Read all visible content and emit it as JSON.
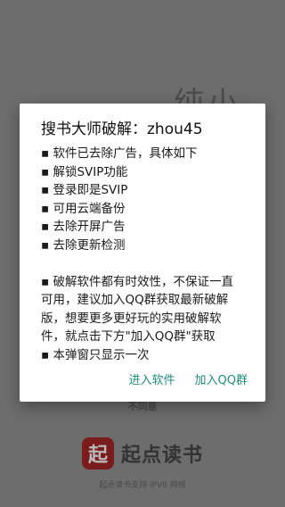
{
  "background": {
    "hand_text": "纯小",
    "disagree_label": "不同意",
    "brand_logo_char": "起",
    "brand_name": "起点读书",
    "support_text": "起点读书支持 IPV6 网络"
  },
  "dialog": {
    "title": "搜书大师破解：zhou45",
    "lines": [
      "▪ 软件已去除广告，具体如下",
      "▪ 解锁SVIP功能",
      "▪ 登录即是SVIP",
      "▪ 可用云端备份",
      "▪ 去除开屏广告",
      "▪ 去除更新检测",
      "",
      "▪ 破解软件都有时效性，不保证一直",
      "可用，建议加入QQ群获取最新破解",
      "版，想要更多更好玩的实用破解软",
      "件，就点击下方\"加入QQ群\"获取",
      "▪ 本弹窗只显示一次"
    ],
    "enter_button": "进入软件",
    "join_button": "加入QQ群"
  },
  "colors": {
    "accent": "#1f8f7d",
    "brand_logo": "#7a1c1c"
  }
}
